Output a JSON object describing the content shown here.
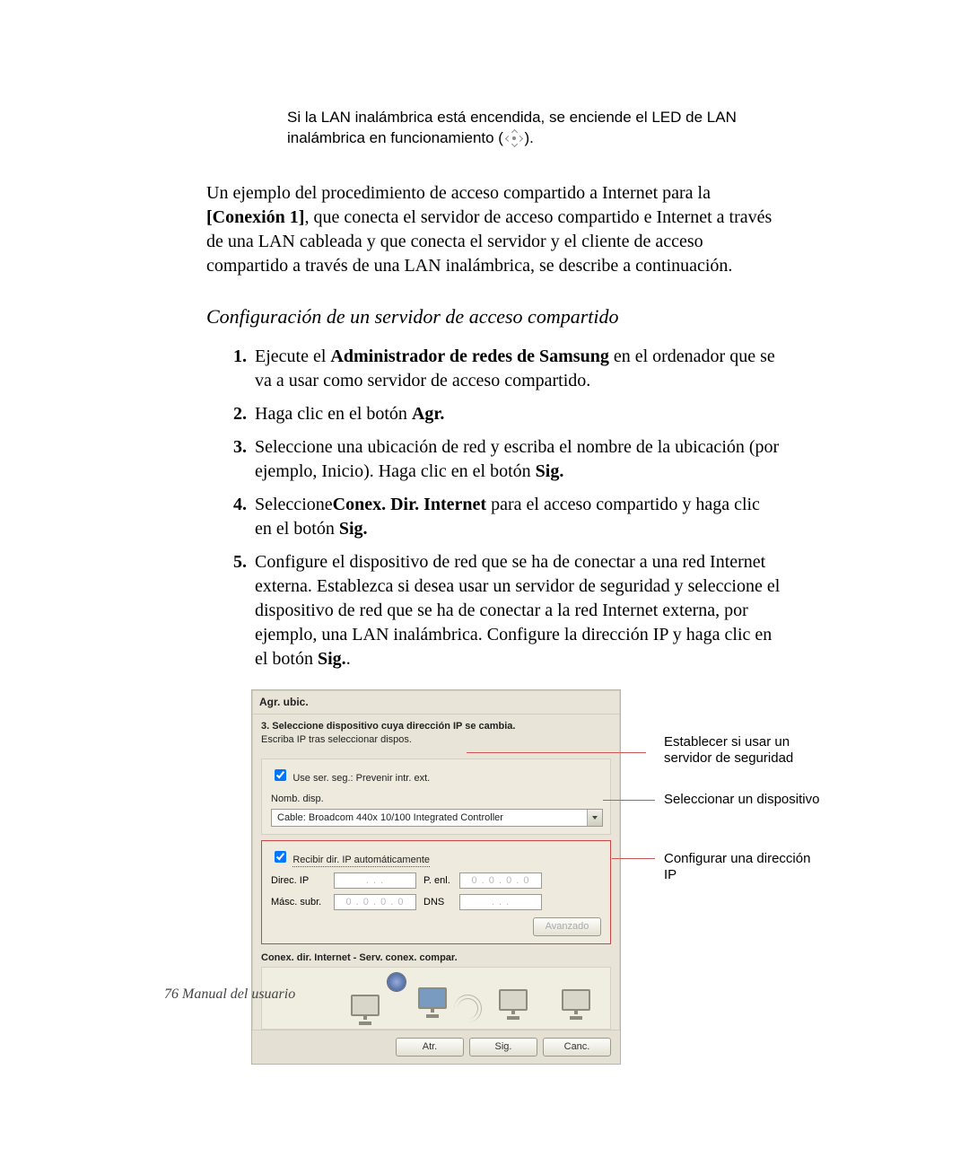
{
  "note": {
    "text_a": "Si la LAN inalámbrica está encendida, se enciende el LED de LAN inalámbrica en funcionamiento (",
    "text_b": ")."
  },
  "paragraph": {
    "pre": "Un ejemplo del procedimiento de acceso compartido a Internet para la ",
    "conn": "[Conexión 1]",
    "post": ", que conecta el servidor de acceso compartido e Internet a través de una LAN cableada y que conecta el servidor y el cliente de acceso compartido a través de una LAN inalámbrica, se describe a continuación."
  },
  "section_title": "Configuración de un servidor de acceso compartido",
  "steps": {
    "s1_a": "Ejecute el ",
    "s1_b": "Administrador de redes de Samsung",
    "s1_c": " en el ordenador que se va a usar como servidor de acceso compartido.",
    "s2_a": "Haga clic en el botón ",
    "s2_b": "Agr.",
    "s3_a": "Seleccione una ubicación de red y escriba el nombre de la ubicación (por ejemplo, Inicio). Haga clic en el botón ",
    "s3_b": "Sig.",
    "s4_a": "Seleccione",
    "s4_b": "Conex. Dir. Internet",
    "s4_c": " para el acceso compartido y haga clic en el botón ",
    "s4_d": "Sig.",
    "s5_a": "Configure el dispositivo de red que se ha de conectar a una red Internet externa. Establezca si desea usar un servidor de seguridad y seleccione el dispositivo de red que se ha de conectar a la red Internet externa, por ejemplo, una LAN inalámbrica. Configure la dirección IP y haga clic en el botón  ",
    "s5_b": "Sig.",
    "s5_c": "."
  },
  "dialog": {
    "title": "Agr. ubic.",
    "heading": "3. Seleccione dispositivo cuya dirección IP se cambia.",
    "subheading": "Escriba IP tras seleccionar dispos.",
    "check_security": "Use ser. seg.: Prevenir intr. ext.",
    "device_label": "Nomb. disp.",
    "device_value": "Cable: Broadcom 440x 10/100 Integrated Controller",
    "check_autoip": "Recibir dir. IP automáticamente",
    "ip_label": "Direc. IP",
    "mask_label": "Másc. subr.",
    "gw_label": "P. enl.",
    "dns_label": "DNS",
    "ip_placeholder_dots": ".   .   .",
    "ip_placeholder_zeros": "0 . 0 . 0 . 0",
    "btn_advanced": "Avanzado",
    "diagram_title": "Conex. dir. Internet - Serv. conex. compar.",
    "btn_back": "Atr.",
    "btn_next": "Sig.",
    "btn_cancel": "Canc."
  },
  "callouts": {
    "c1": "Establecer si usar un servidor de seguridad",
    "c2": "Seleccionar un dispositivo",
    "c3": "Configurar una dirección IP"
  },
  "footer": "76  Manual del usuario"
}
